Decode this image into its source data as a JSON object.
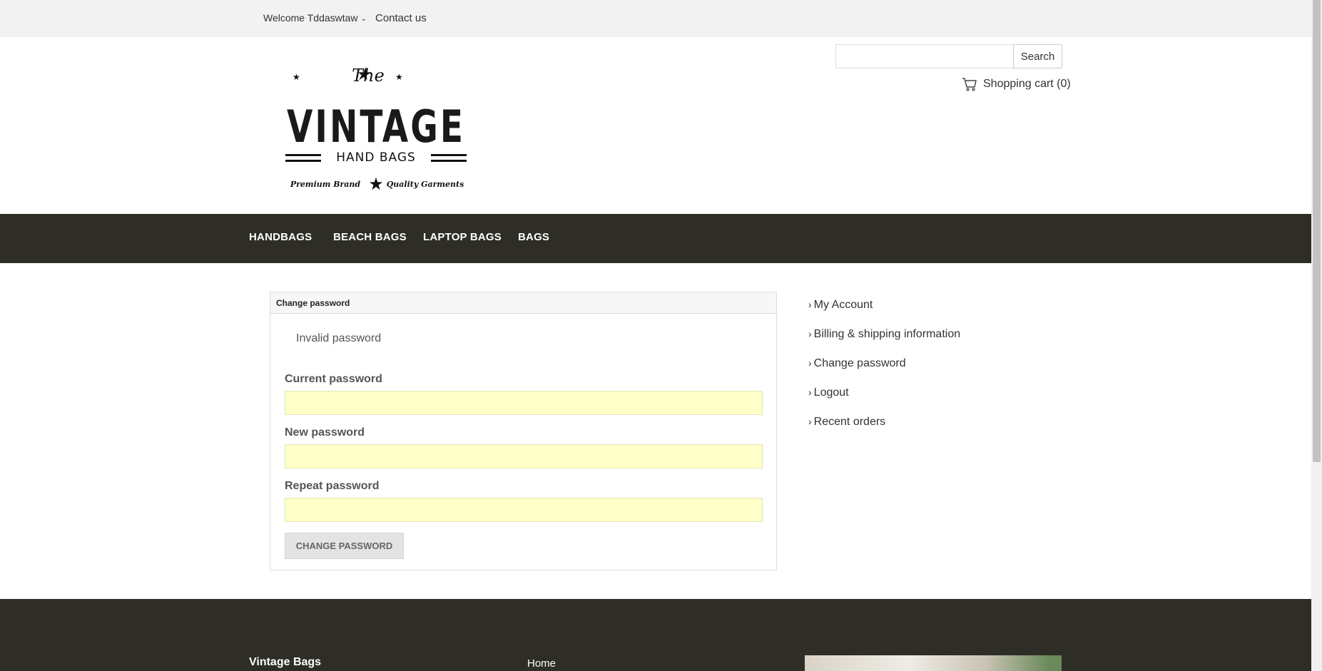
{
  "topbar": {
    "welcome": "Welcome Tddaswtaw",
    "contact": "Contact us"
  },
  "logo": {
    "the": "The",
    "vintage": "VINTAGE",
    "hand_bags": "HAND BAGS",
    "premium": "Premium Brand",
    "quality": "Quality Garments"
  },
  "search": {
    "button": "Search",
    "value": ""
  },
  "cart": {
    "label": "Shopping cart (0)",
    "icon": "cart-icon"
  },
  "nav": {
    "items": [
      {
        "label": "HANDBAGS"
      },
      {
        "label": "BEACH BAGS"
      },
      {
        "label": "LAPTOP BAGS"
      },
      {
        "label": "BAGS"
      }
    ]
  },
  "form": {
    "heading": "Change password",
    "error": "Invalid password",
    "current_label": "Current password",
    "new_label": "New password",
    "repeat_label": "Repeat password",
    "submit": "CHANGE PASSWORD"
  },
  "sidebar": {
    "items": [
      {
        "label": "My Account"
      },
      {
        "label": "Billing & shipping information"
      },
      {
        "label": "Change password"
      },
      {
        "label": "Logout"
      },
      {
        "label": "Recent orders"
      }
    ]
  },
  "footer": {
    "brand": "Vintage Bags",
    "home": "Home"
  },
  "colors": {
    "nav_bg": "#2e2d26",
    "input_bg": "#ffffc8"
  }
}
